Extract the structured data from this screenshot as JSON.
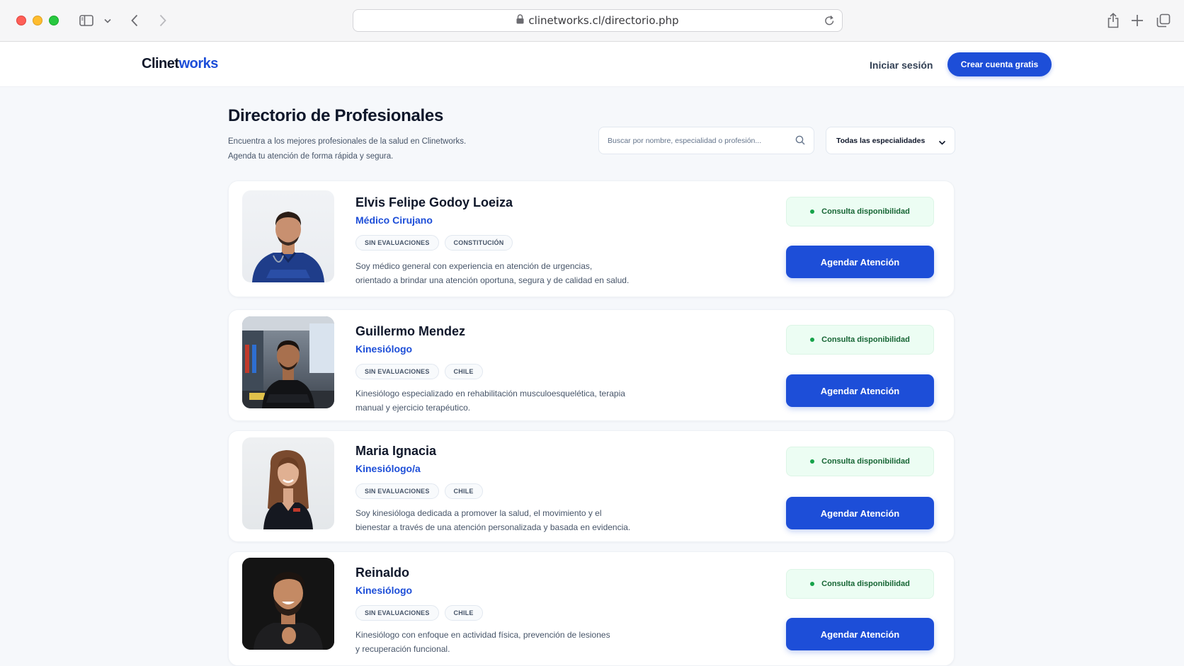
{
  "browser": {
    "url": "clinetworks.cl/directorio.php"
  },
  "header": {
    "logo_part1": "Clinet",
    "logo_part2": "works",
    "login_label": "Iniciar sesión",
    "signup_label": "Crear cuenta gratis"
  },
  "page": {
    "title": "Directorio de Profesionales",
    "subtitle_line1": "Encuentra a los mejores profesionales de la salud en Clinetworks.",
    "subtitle_line2": "Agenda tu atención de forma rápida y segura.",
    "search_placeholder": "Buscar por nombre, especialidad o profesión...",
    "filter_label": "Todas las especialidades"
  },
  "colors": {
    "accent": "#1d4ed8",
    "available_bg": "#ecfdf3",
    "available_text": "#166534"
  },
  "professionals": [
    {
      "name": "Elvis Felipe Godoy Loeiza",
      "specialty": "Médico Cirujano",
      "tags": [
        "SIN EVALUACIONES",
        "CONSTITUCIÓN"
      ],
      "description_line1": "Soy médico general con experiencia en atención de urgencias,",
      "description_line2": "orientado a brindar una atención oportuna, segura y de calidad en salud.",
      "availability": "Consulta disponibilidad",
      "button": "Agendar Atención"
    },
    {
      "name": "Guillermo Mendez",
      "specialty": "Kinesiólogo",
      "tags": [
        "SIN EVALUACIONES",
        "CHILE"
      ],
      "description_line1": "Kinesiólogo especializado en rehabilitación musculoesquelética, terapia",
      "description_line2": "manual y ejercicio terapéutico.",
      "availability": "Consulta disponibilidad",
      "button": "Agendar Atención"
    },
    {
      "name": "Maria Ignacia",
      "specialty": "Kinesiólogo/a",
      "tags": [
        "SIN EVALUACIONES",
        "CHILE"
      ],
      "description_line1": "Soy kinesióloga dedicada a promover la salud, el movimiento y el",
      "description_line2": "bienestar a través de una atención personalizada y basada en evidencia.",
      "availability": "Consulta disponibilidad",
      "button": "Agendar Atención"
    },
    {
      "name": "Reinaldo",
      "specialty": "Kinesiólogo",
      "tags": [
        "SIN EVALUACIONES",
        "CHILE"
      ],
      "description_line1": "Kinesiólogo con enfoque en actividad física, prevención de lesiones",
      "description_line2": "y recuperación funcional.",
      "availability": "Consulta disponibilidad",
      "button": "Agendar Atención"
    }
  ]
}
